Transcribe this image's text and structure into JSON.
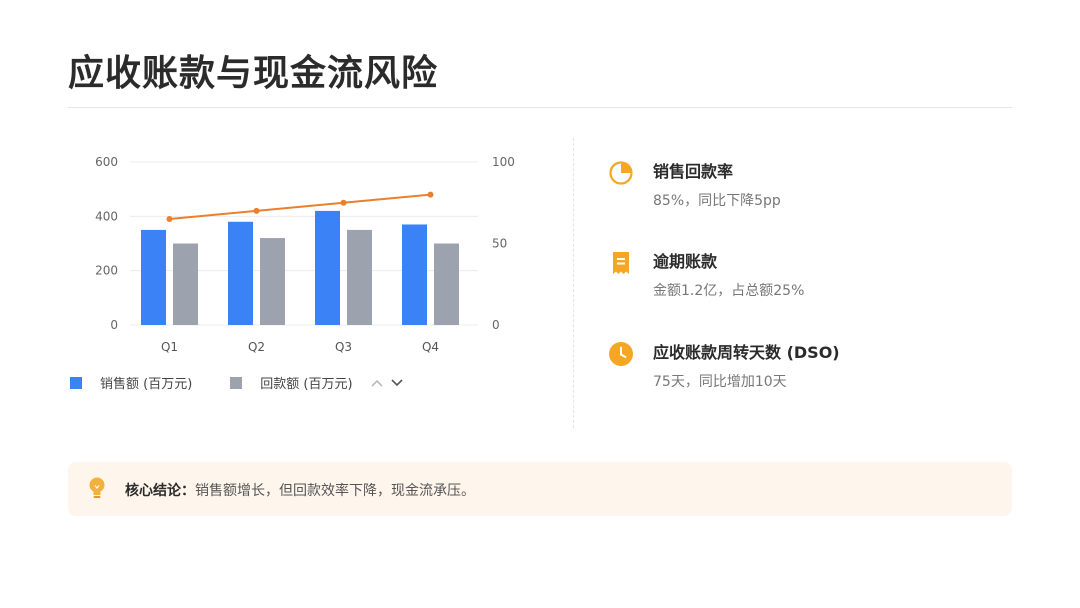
{
  "page": {
    "title": "应收账款与现金流风险"
  },
  "chart_data": {
    "type": "bar",
    "categories": [
      "Q1",
      "Q2",
      "Q3",
      "Q4"
    ],
    "series": [
      {
        "name": "销售额 (百万元)",
        "type": "bar",
        "axis": "left",
        "color": "#3b82f6",
        "values": [
          350,
          380,
          420,
          370
        ]
      },
      {
        "name": "回款额 (百万元)",
        "type": "bar",
        "axis": "left",
        "color": "#9ca3af",
        "values": [
          300,
          320,
          350,
          300
        ]
      },
      {
        "type": "line",
        "axis": "right",
        "color": "#ea7f2c",
        "values": [
          65,
          70,
          75,
          80
        ]
      }
    ],
    "y_left": {
      "min": 0,
      "max": 600,
      "ticks": [
        0,
        200,
        400,
        600
      ]
    },
    "y_right": {
      "min": 0,
      "max": 100,
      "ticks": [
        0,
        50,
        100
      ]
    },
    "grid": true,
    "legend": "bottom"
  },
  "legend": {
    "items": [
      {
        "label": "销售额 (百万元)",
        "color": "#3b82f6"
      },
      {
        "label": "回款额 (百万元)",
        "color": "#9ca3af"
      }
    ],
    "prev_icon": "chevron-up-icon",
    "next_icon": "chevron-down-icon"
  },
  "metrics": [
    {
      "icon": "pie-chart-icon",
      "title": "销售回款率",
      "desc": "85%，同比下降5pp",
      "color": "#f5a623"
    },
    {
      "icon": "receipt-icon",
      "title": "逾期账款",
      "desc": "金额1.2亿，占总额25%",
      "color": "#f5a623"
    },
    {
      "icon": "clock-icon",
      "title": "应收账款周转天数 (DSO)",
      "desc": "75天，同比增加10天",
      "color": "#f5a623"
    }
  ],
  "conclusion": {
    "label": "核心结论：",
    "text": "销售额增长，但回款效率下降，现金流承压。",
    "icon": "lightbulb-icon"
  }
}
